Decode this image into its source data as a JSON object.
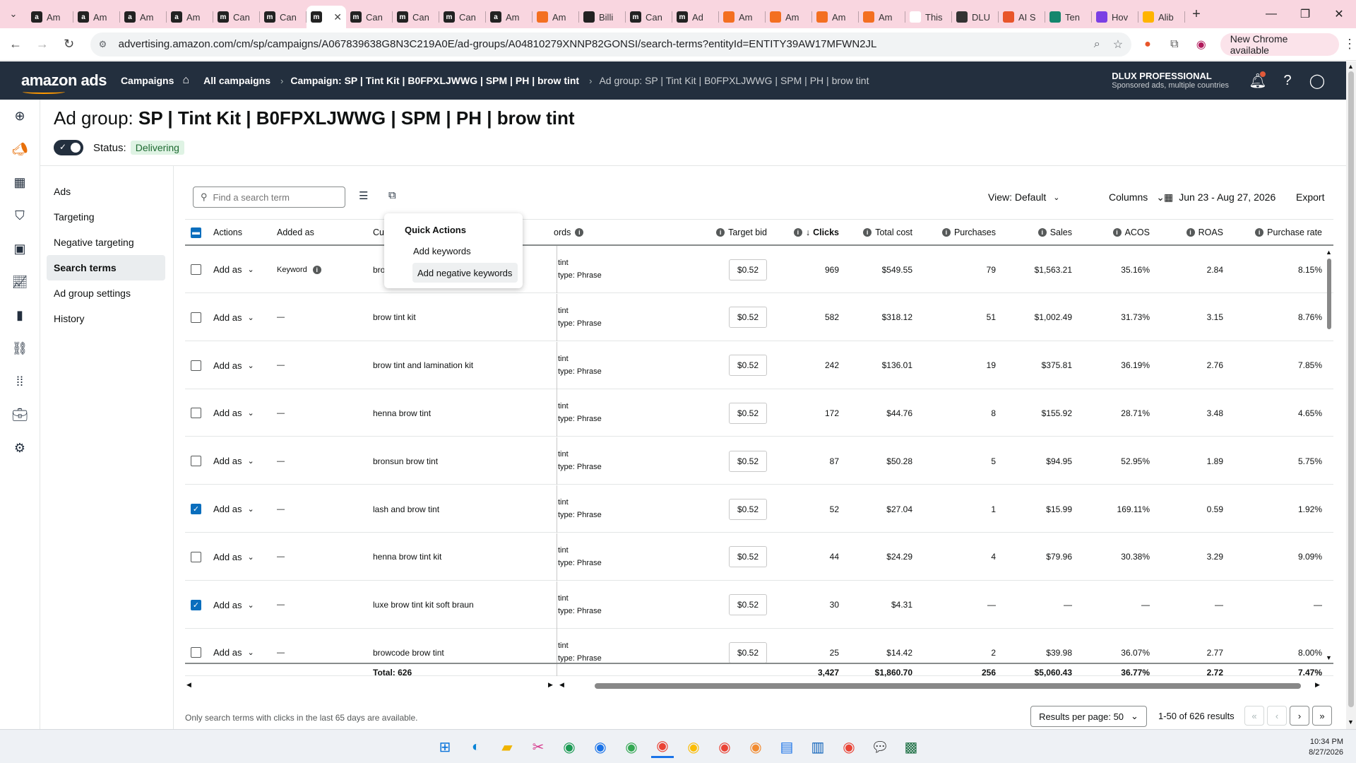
{
  "browser": {
    "tabs": [
      {
        "label": "Am",
        "fav": "a",
        "color": "#222"
      },
      {
        "label": "Am",
        "fav": "a",
        "color": "#222"
      },
      {
        "label": "Am",
        "fav": "a",
        "color": "#222"
      },
      {
        "label": "Am",
        "fav": "a",
        "color": "#222"
      },
      {
        "label": "Can",
        "fav": "m",
        "color": "#222"
      },
      {
        "label": "Can",
        "fav": "m",
        "color": "#222"
      },
      {
        "label": "",
        "fav": "m",
        "color": "#222",
        "active": true
      },
      {
        "label": "Can",
        "fav": "m",
        "color": "#222"
      },
      {
        "label": "Can",
        "fav": "m",
        "color": "#222"
      },
      {
        "label": "Can",
        "fav": "m",
        "color": "#222"
      },
      {
        "label": "Am",
        "fav": "a",
        "color": "#222"
      },
      {
        "label": "Am",
        "fav": "",
        "color": "#f36f21"
      },
      {
        "label": "Billi",
        "fav": "",
        "color": "#222"
      },
      {
        "label": "Can",
        "fav": "m",
        "color": "#222"
      },
      {
        "label": "Ad",
        "fav": "m",
        "color": "#222"
      },
      {
        "label": "Am",
        "fav": "",
        "color": "#f36f21"
      },
      {
        "label": "Am",
        "fav": "",
        "color": "#f36f21"
      },
      {
        "label": "Am",
        "fav": "",
        "color": "#f36f21"
      },
      {
        "label": "Am",
        "fav": "",
        "color": "#f36f21"
      },
      {
        "label": "This",
        "fav": "",
        "color": "#ffffff"
      },
      {
        "label": "DLU",
        "fav": "",
        "color": "#333"
      },
      {
        "label": "AI S",
        "fav": "",
        "color": "#e8552a"
      },
      {
        "label": "Ten",
        "fav": "",
        "color": "#14866d"
      },
      {
        "label": "Hov",
        "fav": "",
        "color": "#7b3fe4"
      },
      {
        "label": "Alib",
        "fav": "",
        "color": "#ffb400"
      }
    ],
    "close_tab": "✕",
    "new_tab": "+",
    "url": "advertising.amazon.com/cm/sp/campaigns/A067839638G8N3C219A0E/ad-groups/A04810279XNNP82GONSI/search-terms?entityId=ENTITY39AW17MFWN2JL",
    "new_chrome": "New Chrome available"
  },
  "header": {
    "logo": "amazon ads",
    "campaigns": "Campaigns",
    "breadcrumb": [
      "All campaigns",
      "Campaign: SP | Tint Kit | B0FPXLJWWG | SPM | PH | brow tint",
      "Ad group: SP | Tint Kit | B0FPXLJWWG | SPM | PH | brow tint"
    ],
    "account_name": "DLUX PROFESSIONAL",
    "account_sub": "Sponsored ads, multiple countries"
  },
  "page": {
    "title_prefix": "Ad group: ",
    "title_name": "SP | Tint Kit | B0FPXLJWWG | SPM | PH | brow tint",
    "status_label": "Status:",
    "status_value": "Delivering"
  },
  "subnav": [
    "Ads",
    "Targeting",
    "Negative targeting",
    "Search terms",
    "Ad group settings",
    "History"
  ],
  "toolbar": {
    "search_placeholder": "Find a search term",
    "view": "View: Default",
    "columns": "Columns",
    "date_range": "Jun 23 - Aug 27, 2026",
    "export": "Export"
  },
  "table": {
    "headers": {
      "actions": "Actions",
      "added_as": "Added as",
      "customer_search_term": "Cus",
      "keywords": "ords",
      "target_bid": "Target bid",
      "clicks": "Clicks",
      "total_cost": "Total cost",
      "purchases": "Purchases",
      "sales": "Sales",
      "acos": "ACOS",
      "roas": "ROAS",
      "purchase_rate": "Purchase rate"
    },
    "rows": [
      {
        "checked": false,
        "action": "Add as",
        "added_as": "Keyword",
        "term": "bro",
        "match1": "tint",
        "match2": "type: Phrase",
        "bid": "$0.52",
        "clicks": "969",
        "cost": "$549.55",
        "purchases": "79",
        "sales": "$1,563.21",
        "acos": "35.16%",
        "roas": "2.84",
        "rate": "8.15%"
      },
      {
        "checked": false,
        "action": "Add as",
        "added_as": "—",
        "term": "brow tint kit",
        "match1": "tint",
        "match2": "type: Phrase",
        "bid": "$0.52",
        "clicks": "582",
        "cost": "$318.12",
        "purchases": "51",
        "sales": "$1,002.49",
        "acos": "31.73%",
        "roas": "3.15",
        "rate": "8.76%"
      },
      {
        "checked": false,
        "action": "Add as",
        "added_as": "—",
        "term": "brow tint and lamination kit",
        "match1": "tint",
        "match2": "type: Phrase",
        "bid": "$0.52",
        "clicks": "242",
        "cost": "$136.01",
        "purchases": "19",
        "sales": "$375.81",
        "acos": "36.19%",
        "roas": "2.76",
        "rate": "7.85%"
      },
      {
        "checked": false,
        "action": "Add as",
        "added_as": "—",
        "term": "henna brow tint",
        "match1": "tint",
        "match2": "type: Phrase",
        "bid": "$0.52",
        "clicks": "172",
        "cost": "$44.76",
        "purchases": "8",
        "sales": "$155.92",
        "acos": "28.71%",
        "roas": "3.48",
        "rate": "4.65%"
      },
      {
        "checked": false,
        "action": "Add as",
        "added_as": "—",
        "term": "bronsun brow tint",
        "match1": "tint",
        "match2": "type: Phrase",
        "bid": "$0.52",
        "clicks": "87",
        "cost": "$50.28",
        "purchases": "5",
        "sales": "$94.95",
        "acos": "52.95%",
        "roas": "1.89",
        "rate": "5.75%"
      },
      {
        "checked": true,
        "action": "Add as",
        "added_as": "—",
        "term": "lash and brow tint",
        "match1": "tint",
        "match2": "type: Phrase",
        "bid": "$0.52",
        "clicks": "52",
        "cost": "$27.04",
        "purchases": "1",
        "sales": "$15.99",
        "acos": "169.11%",
        "roas": "0.59",
        "rate": "1.92%"
      },
      {
        "checked": false,
        "action": "Add as",
        "added_as": "—",
        "term": "henna brow tint kit",
        "match1": "tint",
        "match2": "type: Phrase",
        "bid": "$0.52",
        "clicks": "44",
        "cost": "$24.29",
        "purchases": "4",
        "sales": "$79.96",
        "acos": "30.38%",
        "roas": "3.29",
        "rate": "9.09%"
      },
      {
        "checked": true,
        "action": "Add as",
        "added_as": "—",
        "term": "luxe brow tint kit soft braun",
        "match1": "tint",
        "match2": "type: Phrase",
        "bid": "$0.52",
        "clicks": "30",
        "cost": "$4.31",
        "purchases": "—",
        "sales": "—",
        "acos": "—",
        "roas": "—",
        "rate": "—"
      },
      {
        "checked": false,
        "action": "Add as",
        "added_as": "—",
        "term": "browcode brow tint",
        "match1": "tint",
        "match2": "type: Phrase",
        "bid": "$0.52",
        "clicks": "25",
        "cost": "$14.42",
        "purchases": "2",
        "sales": "$39.98",
        "acos": "36.07%",
        "roas": "2.77",
        "rate": "8.00%"
      }
    ],
    "totals": {
      "label": "Total: 626",
      "clicks": "3,427",
      "cost": "$1,860.70",
      "purchases": "256",
      "sales": "$5,060.43",
      "acos": "36.77%",
      "roas": "2.72",
      "rate": "7.47%"
    }
  },
  "quick_actions": {
    "title": "Quick Actions",
    "items": [
      "Add keywords",
      "Add negative keywords"
    ]
  },
  "footer": {
    "note": "Only search terms with clicks in the last 65 days are available.",
    "results_per_page": "Results per page: 50",
    "range": "1-50 of 626 results"
  },
  "taskbar": {
    "time": "10:34 PM",
    "date": "8/27/2026"
  }
}
